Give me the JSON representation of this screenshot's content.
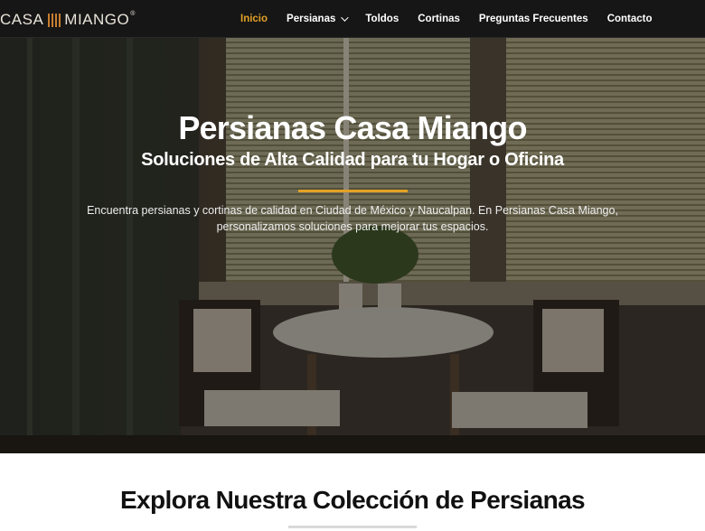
{
  "brand": {
    "name_left": "CASA",
    "name_right": "MIANGO",
    "registered": "®",
    "accent_color": "#e2a126"
  },
  "nav": {
    "items": [
      {
        "label": "Inicio",
        "active": true
      },
      {
        "label": "Persianas",
        "has_dropdown": true
      },
      {
        "label": "Toldos"
      },
      {
        "label": "Cortinas"
      },
      {
        "label": "Preguntas Frecuentes"
      },
      {
        "label": "Contacto"
      }
    ]
  },
  "hero": {
    "title": "Persianas Casa Miango",
    "subtitle": "Soluciones de Alta Calidad para tu Hogar o Oficina",
    "text_line1": "Encuentra persianas y cortinas de calidad en Ciudad de México y Naucalpan. En Persianas Casa Miango,",
    "text_line2": "personalizamos soluciones para mejorar tus espacios."
  },
  "section": {
    "title": "Explora Nuestra Colección de Persianas"
  }
}
